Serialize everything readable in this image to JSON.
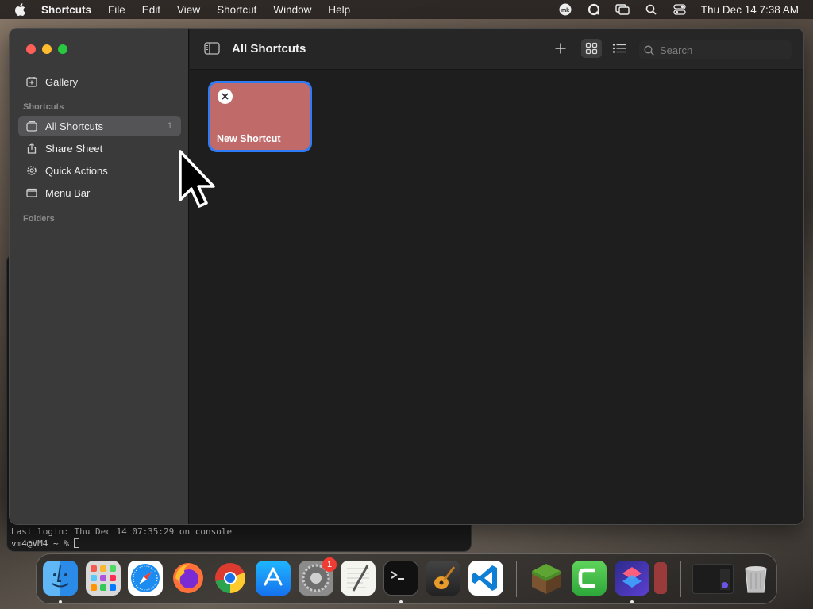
{
  "menubar": {
    "app_name": "Shortcuts",
    "items": [
      "File",
      "Edit",
      "View",
      "Shortcut",
      "Window",
      "Help"
    ],
    "status_icons": [
      "mk-icon",
      "quicktime-icon",
      "screen-mirroring-icon",
      "spotlight-icon",
      "control-center-icon"
    ],
    "clock": "Thu Dec 14  7:38 AM"
  },
  "window": {
    "title": "All Shortcuts",
    "sidebar": {
      "gallery": "Gallery",
      "section_shortcuts": "Shortcuts",
      "items": [
        {
          "label": "All Shortcuts",
          "count": "1",
          "icon": "all-shortcuts-icon"
        },
        {
          "label": "Share Sheet",
          "icon": "share-sheet-icon"
        },
        {
          "label": "Quick Actions",
          "icon": "quick-actions-gear-icon"
        },
        {
          "label": "Menu Bar",
          "icon": "menu-bar-icon"
        }
      ],
      "section_folders": "Folders"
    },
    "toolbar": {
      "search_placeholder": "Search"
    },
    "shortcut_card": {
      "label": "New Shortcut",
      "color": "#c06a69"
    }
  },
  "terminal": {
    "line1": "Last login: Thu Dec 14 07:35:29 on console",
    "line2": "vm4@VM4 ~ % "
  },
  "dock": {
    "apps": [
      "Finder",
      "Launchpad",
      "Safari",
      "Firefox",
      "Chrome",
      "App Store",
      "System Settings",
      "TextEdit",
      "Terminal",
      "GarageBand",
      "Visual Studio Code",
      "Minecraft",
      "Camtasia",
      "Shortcuts",
      "Other",
      "Window Preview",
      "Trash"
    ],
    "settings_badge": "1"
  },
  "colors": {
    "accent": "#2d7cf6",
    "sidebar_bg": "#3a3a3b",
    "main_bg": "#1e1e1e"
  }
}
